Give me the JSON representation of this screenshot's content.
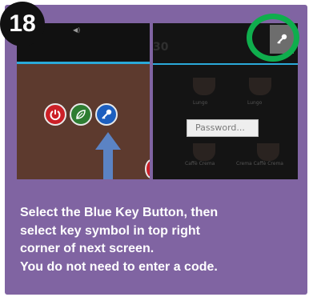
{
  "step": {
    "number": "18"
  },
  "left_screen": {
    "status_items": [
      "",
      ""
    ],
    "buttons": [
      {
        "id": "power",
        "icon": "power-icon",
        "color": "#cc2027"
      },
      {
        "id": "eco",
        "icon": "leaf-icon",
        "color": "#2e7d32"
      },
      {
        "id": "key",
        "icon": "key-icon",
        "color": "#1d5fbf"
      }
    ]
  },
  "right_screen": {
    "counter": "30",
    "cup_labels": [
      "Lungo",
      "Lungo",
      "Caffè Crema",
      "Crema Caffè Crema"
    ],
    "password_placeholder": "Password...",
    "settings_icon": "key-icon"
  },
  "instructions": {
    "line1": "Select the Blue Key Button, then",
    "line2": "select key symbol in top right",
    "line3": "corner of next screen.",
    "line4": "You do not need to enter a code."
  },
  "colors": {
    "card_background": "#8064a2",
    "highlight_ring": "#0fae4d",
    "arrow": "#5b83c4",
    "accent_line": "#2aa9d9"
  }
}
